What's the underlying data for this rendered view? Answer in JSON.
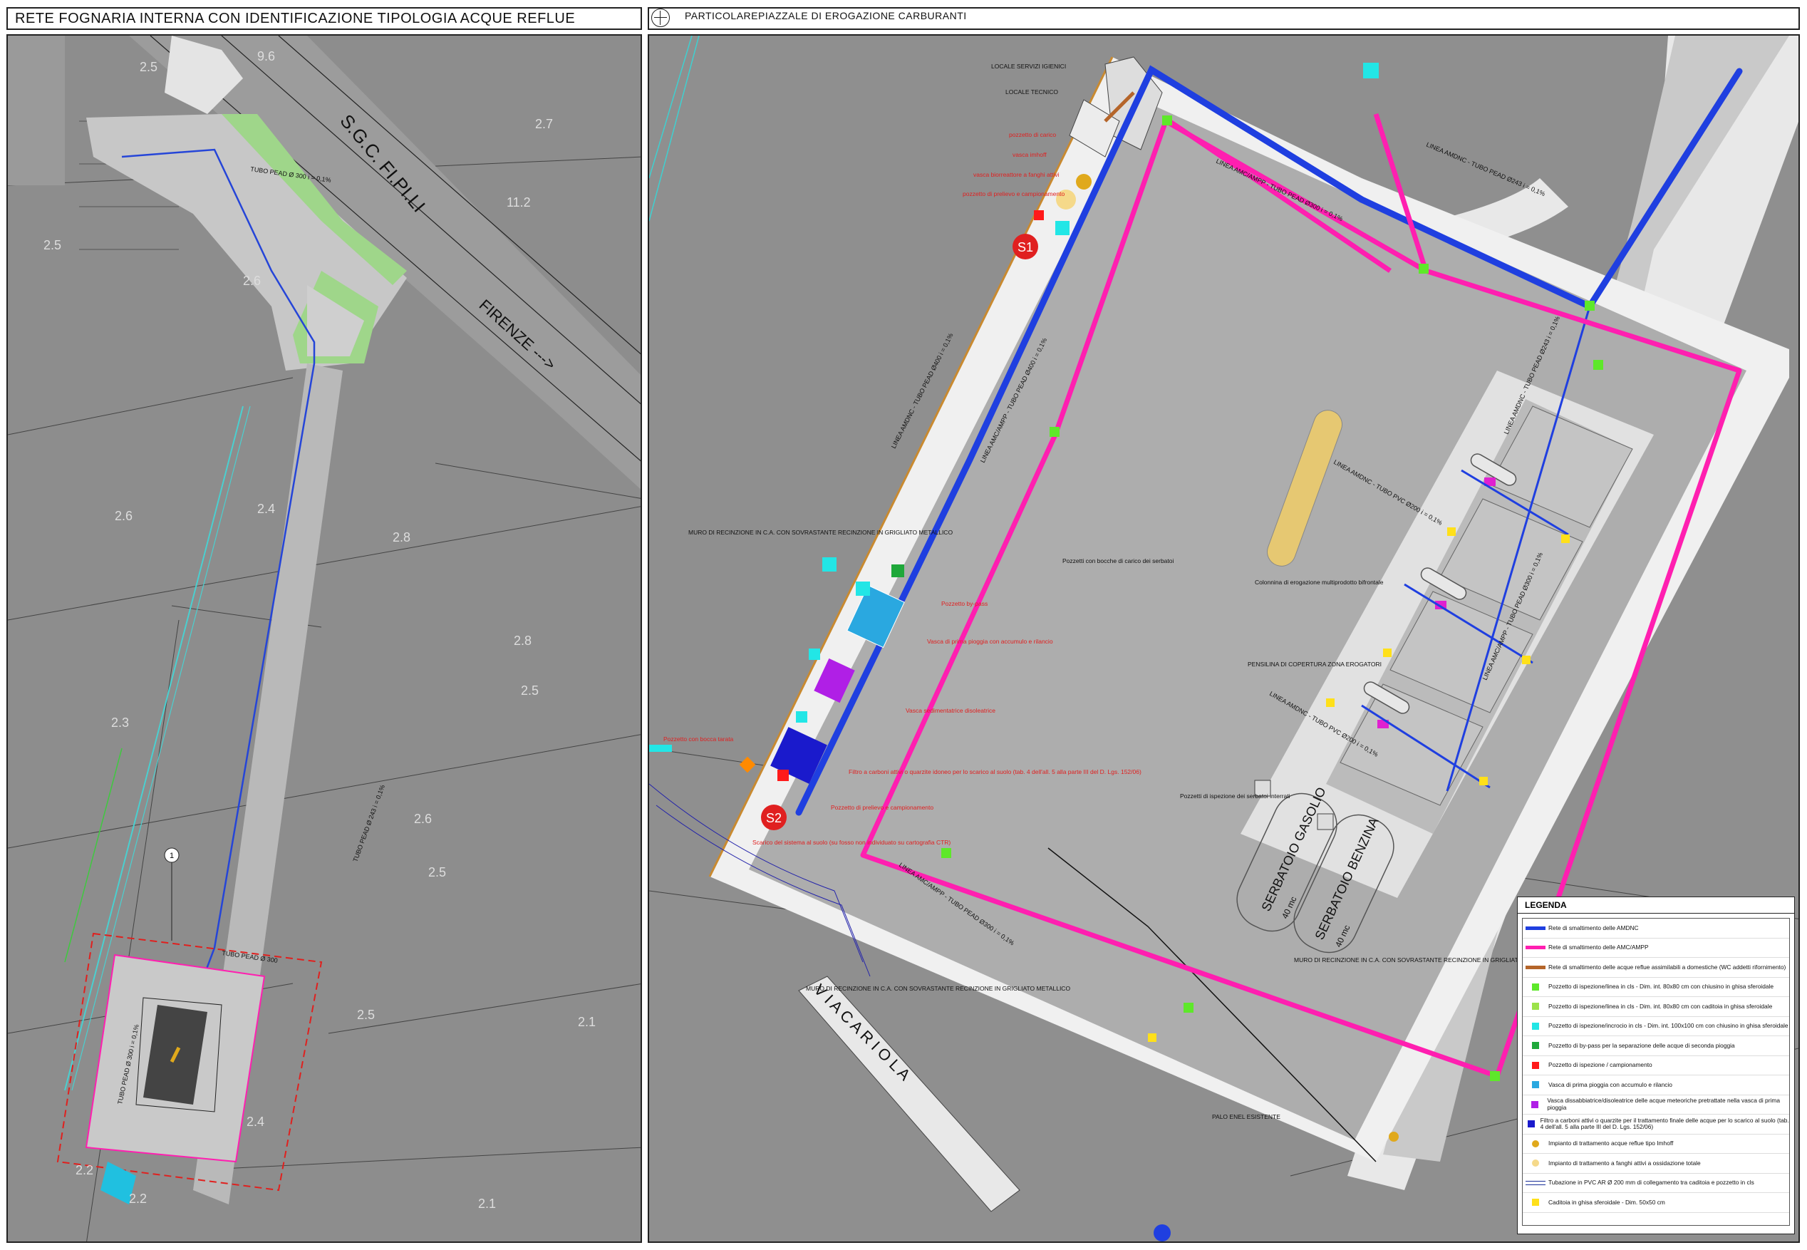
{
  "header": {
    "left_title": "RETE FOGNARIA INTERNA CON IDENTIFICAZIONE TIPOLOGIA ACQUE REFLUE",
    "right_title": "PARTICOLAREPIAZZALE DI EROGAZIONE CARBURANTI"
  },
  "left_plan": {
    "road_name": "S.G.C. FI.PI.LI",
    "direction": "FIRENZE --->",
    "pipe_labels": [
      "TUBO PEAD Ø 300  i = 0,1%",
      "TUBO PEAD Ø 243  i = 0,1%",
      "TUBO PEAD Ø 300",
      "TUBO PEAD Ø 300  i = 0,1%"
    ],
    "detail_marker": "1",
    "elevations": [
      "9.6",
      "2.5",
      "2.7",
      "11.2",
      "2.5",
      "2.6",
      "2.6",
      "2.4",
      "2.8",
      "2.8",
      "2.5",
      "2.3",
      "2.6",
      "2.5",
      "2.5",
      "2.1",
      "2.4",
      "2.2",
      "2.2",
      "2.1"
    ]
  },
  "right_plan": {
    "labels": {
      "locale_servizi": "LOCALE SERVIZI IGIENICI",
      "locale_tecnico": "LOCALE TECNICO",
      "pozzetto_carico": "pozzetto di carico",
      "vasca_imhoff": "vasca imhoff",
      "vasca_biorea": "vasca biorreattore a fanghi attivi",
      "pozzetto_prelievo_top": "pozzetto di prelievo e campionamento",
      "muro_left": "MURO DI RECINZIONE IN C.A. CON SOVRASTANTE RECINZIONE IN GRIGLIATO METALLICO",
      "pozzetto_bypass": "Pozzetto by-pass",
      "vasca_prima_pioggia": "Vasca di prima pioggia con accumulo e rilancio",
      "vasca_sedimentatrice": "Vasca sedimentatrice disoleatrice",
      "pozzetto_bocca": "Pozzetto con bocca tarata",
      "filtro": "Filtro a carboni attivi o quarzite idoneo per lo scarico al suolo (tab. 4 dell'all. 5 alla parte III del D. Lgs. 152/06)",
      "pozzetto_prelievo": "Pozzetto di prelievo e campionamento",
      "scarico": "Scarico del sistema al suolo (su fosso non individuato su cartografia CTR)",
      "pozzetti_bocche": "Pozzetti con bocche di carico dei serbatoi",
      "colonnina": "Colonnina di erogazione multiprodotto bifrontale",
      "pensilina": "PENSILINA DI COPERTURA ZONA EROGATORI",
      "pozzetti_ispezione": "Pozzetti di ispezione dei serbatoi interrati",
      "serbatoio_gasolio": "SERBATOIO GASOLIO",
      "serbatoio_gasolio_cap": "40 mc",
      "serbatoio_benzina": "SERBATOIO BENZINA",
      "serbatoio_benzina_cap": "40 mc",
      "muro_bottom": "MURO DI RECINZIONE IN C.A. CON SOVRASTANTE RECINZIONE IN GRIGLIATO METALLICO",
      "muro_right": "MURO DI RECINZIONE IN C.A. CON SOVRASTANTE RECINZIONE IN GRIGLIATO METALLICO",
      "palo_enel": "PALO ENEL ESISTENTE",
      "via_cariola": "V I A   C A R I O L A",
      "s1": "S1",
      "s2": "S2"
    },
    "line_labels": {
      "amdnc_top": "LINEA AMDNC - TUBO PEAD Ø243  i = 0,1%",
      "amc_top": "LINEA AMC/AMPP - TUBO PEAD Ø300  i = 0,1%",
      "amdnc_left": "LINEA AMDNC - TUBO PEAD Ø400  i = 0,1%",
      "amc_left": "LINEA AMC/AMPP - TUBO PEAD Ø400  i = 0,1%",
      "amdnc_right": "LINEA AMDNC - TUBO PEAD Ø243  i = 0,1%",
      "amc_right": "LINEA AMC/AMPP - TUBO PEAD Ø300  i = 0,1%",
      "amc_bottom": "LINEA AMC/AMPP - TUBO PEAD Ø300  i = 0,1%",
      "amdnc_pvc1": "LINEA AMDNC - TUBO PVC Ø200  i = 0,1%",
      "amdnc_pvc2": "LINEA AMDNC - TUBO PVC Ø200  i = 0,1%"
    }
  },
  "legend": {
    "title": "LEGENDA",
    "items": [
      {
        "symbol": "line",
        "color": "#1f3fe0",
        "text": "Rete di smaltimento delle AMDNC"
      },
      {
        "symbol": "line",
        "color": "#ff1fb0",
        "text": "Rete di smaltimento delle AMC/AMPP"
      },
      {
        "symbol": "line",
        "color": "#b5652a",
        "text": "Rete di smaltimento delle acque reflue assimilabili a domestiche (WC addetti rifornimento)"
      },
      {
        "symbol": "square",
        "color": "#5ee82a",
        "text": "Pozzetto di ispezione/linea in cls - Dim. int. 80x80 cm con chiusino in ghisa sferoidale"
      },
      {
        "symbol": "square",
        "color": "#9be24a",
        "text": "Pozzetto di ispezione/linea in cls - Dim. int. 80x80 cm con caditoia in ghisa sferoidale"
      },
      {
        "symbol": "square",
        "color": "#22e6e6",
        "text": "Pozzetto di ispezione/incrocio in cls - Dim. int. 100x100 cm con chiusino in ghisa sferoidale"
      },
      {
        "symbol": "square",
        "color": "#1fa83a",
        "text": "Pozzetto di by-pass per la separazione delle acque di seconda pioggia"
      },
      {
        "symbol": "square",
        "color": "#ff1a1a",
        "text": "Pozzetto di ispezione / campionamento"
      },
      {
        "symbol": "square",
        "color": "#2aa8e0",
        "text": "Vasca di prima pioggia con accumulo e rilancio"
      },
      {
        "symbol": "square",
        "color": "#b01fe6",
        "text": "Vasca dissabbiatrice/disoleatrice delle acque meteoriche pretrattate nella vasca di prima pioggia"
      },
      {
        "symbol": "square",
        "color": "#1a1acc",
        "text": "Filtro a carboni attivi o quarzite per il trattamento finale delle acque per lo scarico al suolo (tab. 4 dell'all. 5 alla parte III del D. Lgs. 152/06)"
      },
      {
        "symbol": "circle",
        "color": "#e0a91c",
        "text": "Impianto di trattamento acque reflue tipo Imhoff"
      },
      {
        "symbol": "circle",
        "color": "#f5d98a",
        "text": "Impianto di trattamento a fanghi attivi a ossidazione totale"
      },
      {
        "symbol": "pipe",
        "color": "#1a2f99",
        "text": "Tubazione in PVC AR Ø 200 mm di collegamento tra caditoia e pozzetto in cls"
      },
      {
        "symbol": "square",
        "color": "#ffe01a",
        "text": "Caditoia in ghisa sferoidale - Dim. 50x50 cm"
      }
    ]
  }
}
